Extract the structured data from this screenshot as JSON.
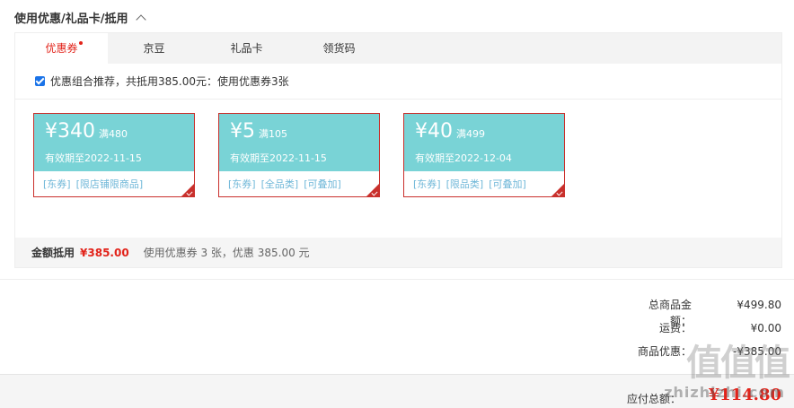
{
  "section_title": "使用优惠/礼品卡/抵用",
  "tabs": [
    {
      "label": "优惠券",
      "active": true
    },
    {
      "label": "京豆",
      "active": false
    },
    {
      "label": "礼品卡",
      "active": false
    },
    {
      "label": "领货码",
      "active": false
    }
  ],
  "recommend_text": "优惠组合推荐，共抵用385.00元：使用优惠券3张",
  "coupons": [
    {
      "amount": "¥340",
      "condition": "满480",
      "valid": "有效期至2022-11-15",
      "tags": [
        "[东券]",
        "[限店铺限商品]"
      ]
    },
    {
      "amount": "¥5",
      "condition": "满105",
      "valid": "有效期至2022-11-15",
      "tags": [
        "[东券]",
        "[全品类]",
        "[可叠加]"
      ]
    },
    {
      "amount": "¥40",
      "condition": "满499",
      "valid": "有效期至2022-12-04",
      "tags": [
        "[东券]",
        "[限品类]",
        "[可叠加]"
      ]
    }
  ],
  "footer": {
    "label": "金额抵用",
    "amount": "¥385.00",
    "desc": "使用优惠券 3 张，优惠 385.00 元"
  },
  "summary": [
    {
      "key": "总商品金额：",
      "value": "¥499.80"
    },
    {
      "key": "运费：",
      "value": "¥0.00"
    },
    {
      "key": "商品优惠：",
      "value": "-¥385.00"
    }
  ],
  "total": {
    "key": "应付总额：",
    "value": "¥114.80"
  },
  "watermark": {
    "logo": "值值值",
    "site": "zhizhizhi.com"
  },
  "colors": {
    "accent": "#e2231a",
    "coupon_bg": "#79d3d6",
    "coupon_border": "#c9302c"
  }
}
